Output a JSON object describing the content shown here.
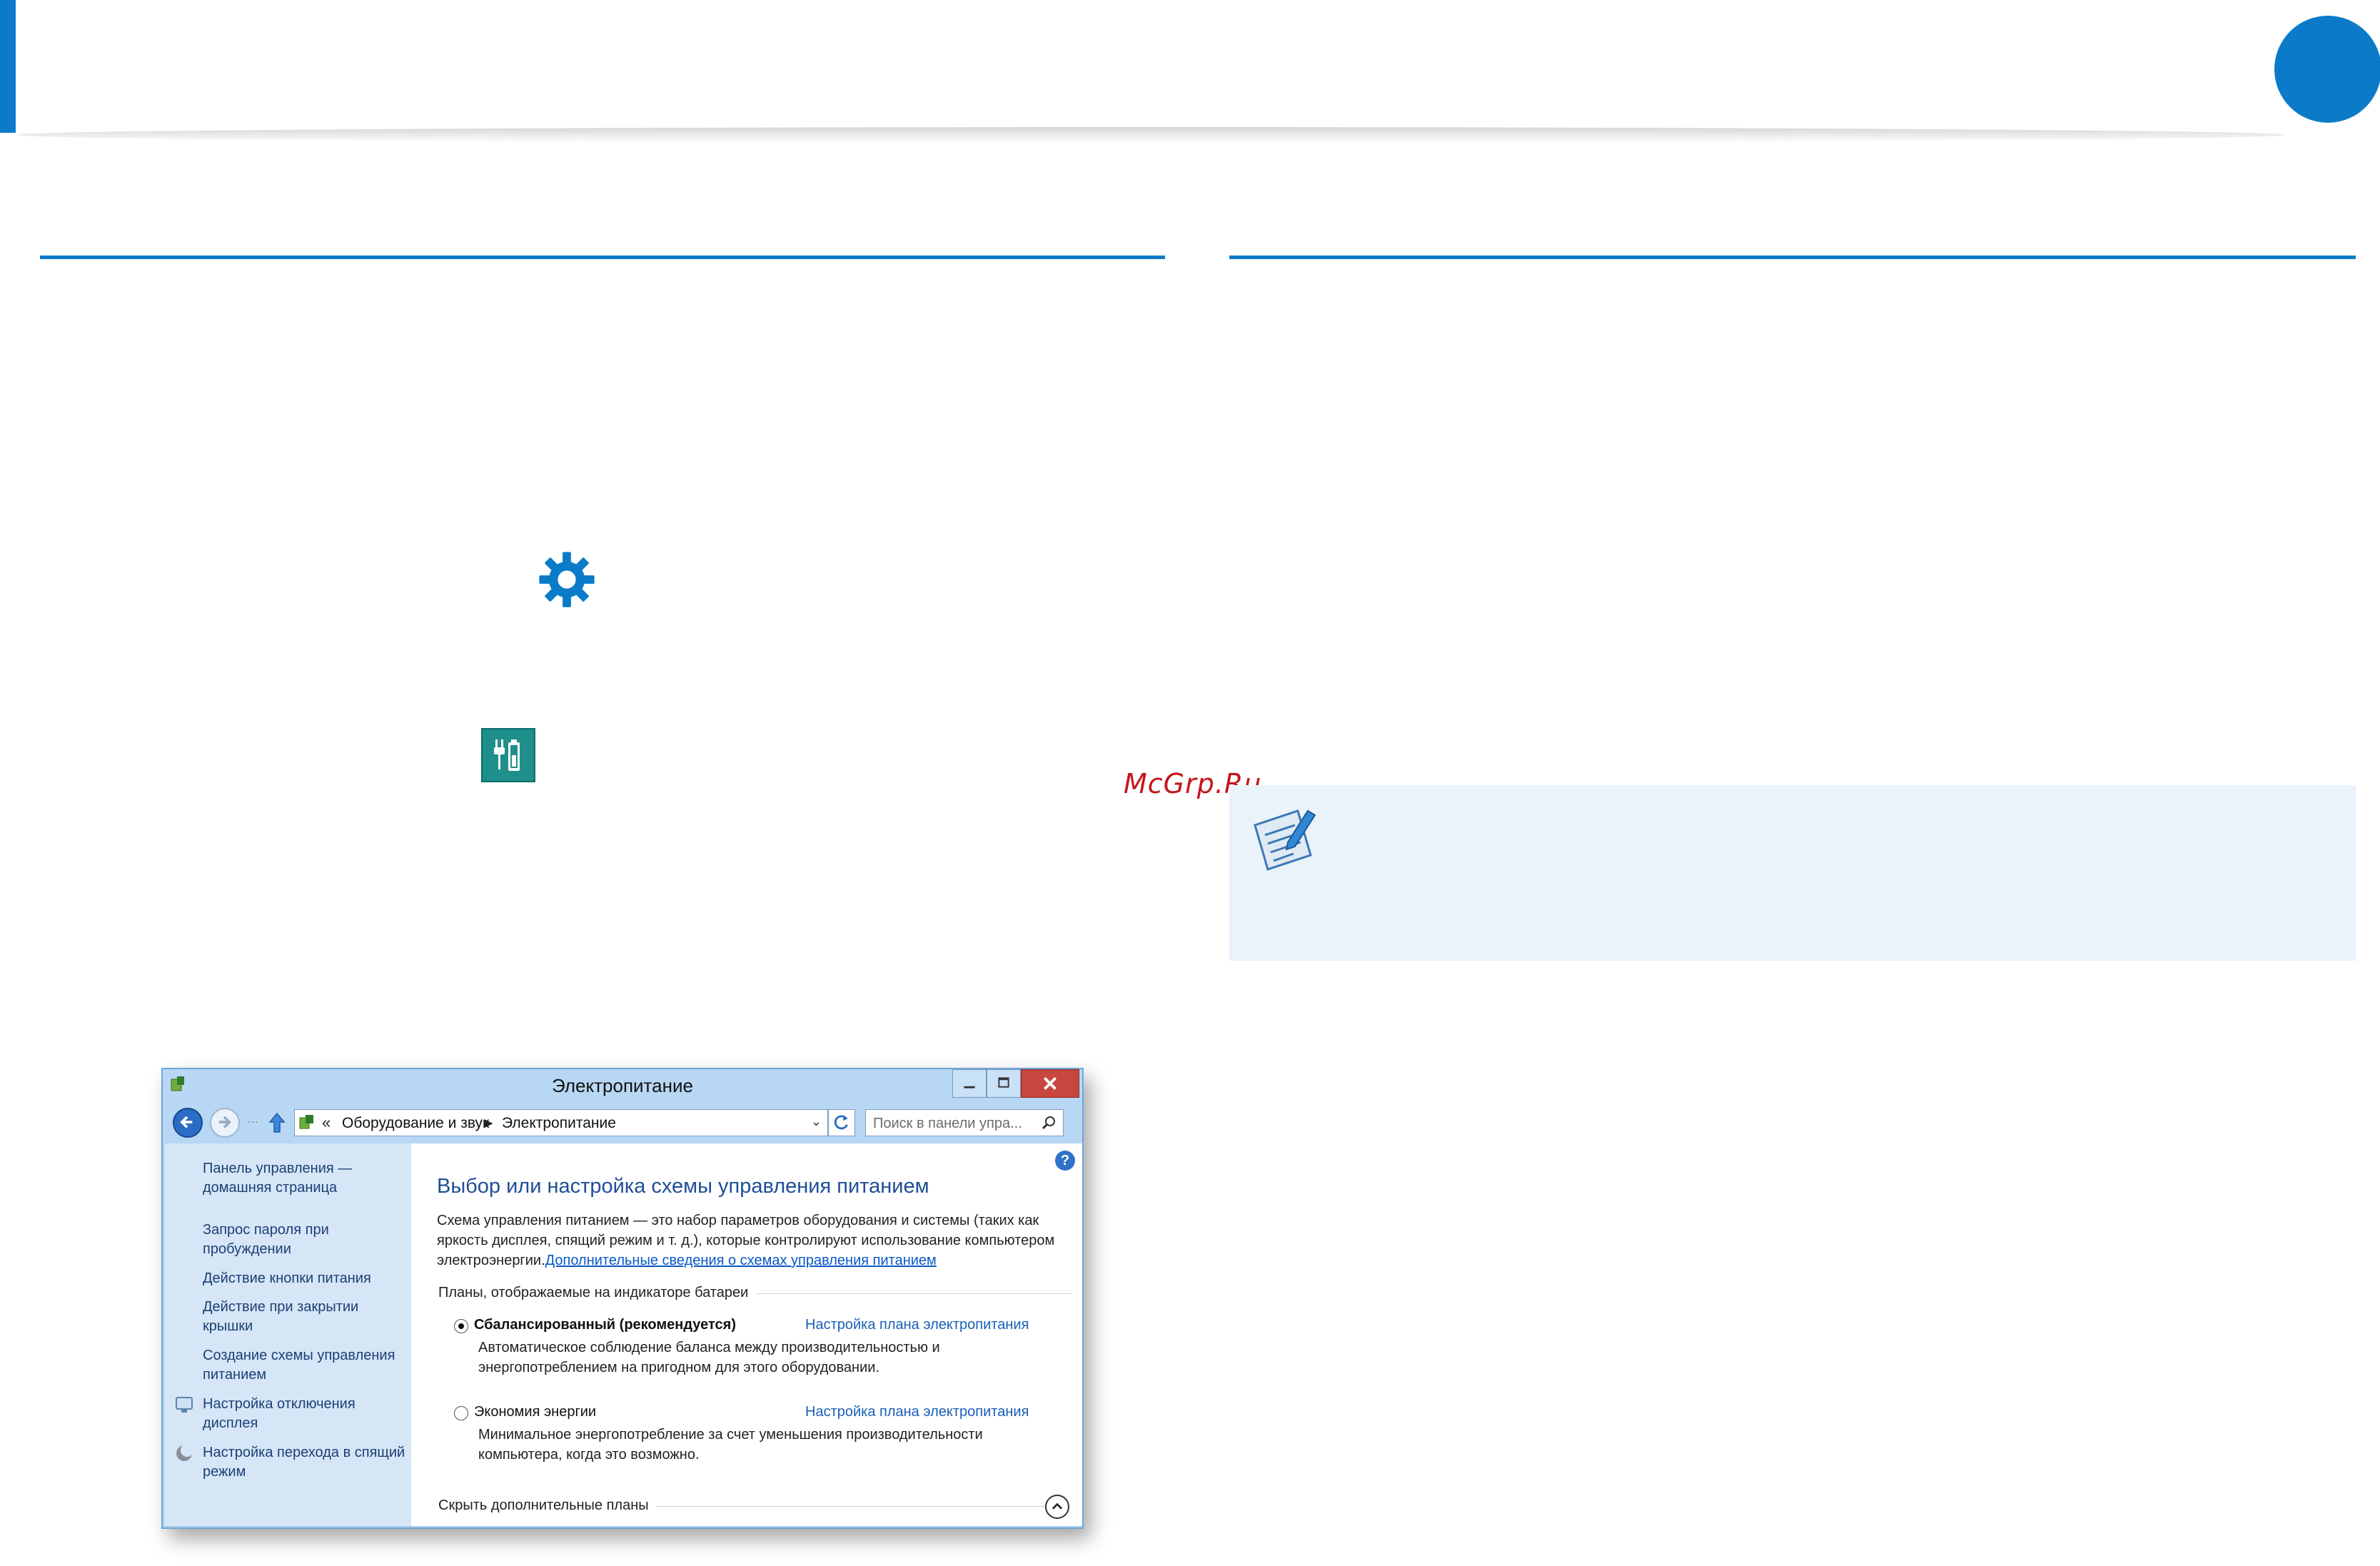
{
  "colors": {
    "accent": "#0b7bc9",
    "note_bg": "#eaf2fa",
    "power_tile": "#1e8f8a",
    "watermark": "#c4161c"
  },
  "icons": {
    "settings": "gear-icon",
    "power_options": "power-plug-battery-icon",
    "note": "note-pencil-icon"
  },
  "watermark": "McGrp.Ru",
  "window": {
    "title": "Электропитание",
    "nav": {
      "breadcrumb": [
        "Оборудование и звук",
        "Электропитание"
      ],
      "address_prefix": "«",
      "search_placeholder": "Поиск в панели упра..."
    },
    "sidebar": {
      "links": [
        "Панель управления — домашняя страница",
        "Запрос пароля при пробуждении",
        "Действие кнопки питания",
        "Действие при закрытии крышки",
        "Создание схемы управления питанием",
        "Настройка отключения дисплея",
        "Настройка перехода в спящий режим"
      ]
    },
    "content": {
      "help": "?",
      "heading": "Выбор или настройка схемы управления питанием",
      "description": "Схема управления питанием — это набор параметров оборудования и системы (таких как яркость дисплея, спящий режим и т. д.), которые контролируют использование компьютером электроэнергии.",
      "description_link": "Дополнительные сведения о схемах управления питанием",
      "section_title": "Планы, отображаемые на индикаторе батареи",
      "plans": [
        {
          "name": "Сбалансированный (рекомендуется)",
          "selected": true,
          "link": "Настройка плана электропитания",
          "description": "Автоматическое соблюдение баланса между производительностью и энергопотреблением на пригодном для этого оборудовании."
        },
        {
          "name": "Экономия энергии",
          "selected": false,
          "link": "Настройка плана электропитания",
          "description": "Минимальное энергопотребление за счет уменьшения производительности компьютера, когда это возможно."
        }
      ],
      "hide_plans": "Скрыть дополнительные планы"
    }
  }
}
